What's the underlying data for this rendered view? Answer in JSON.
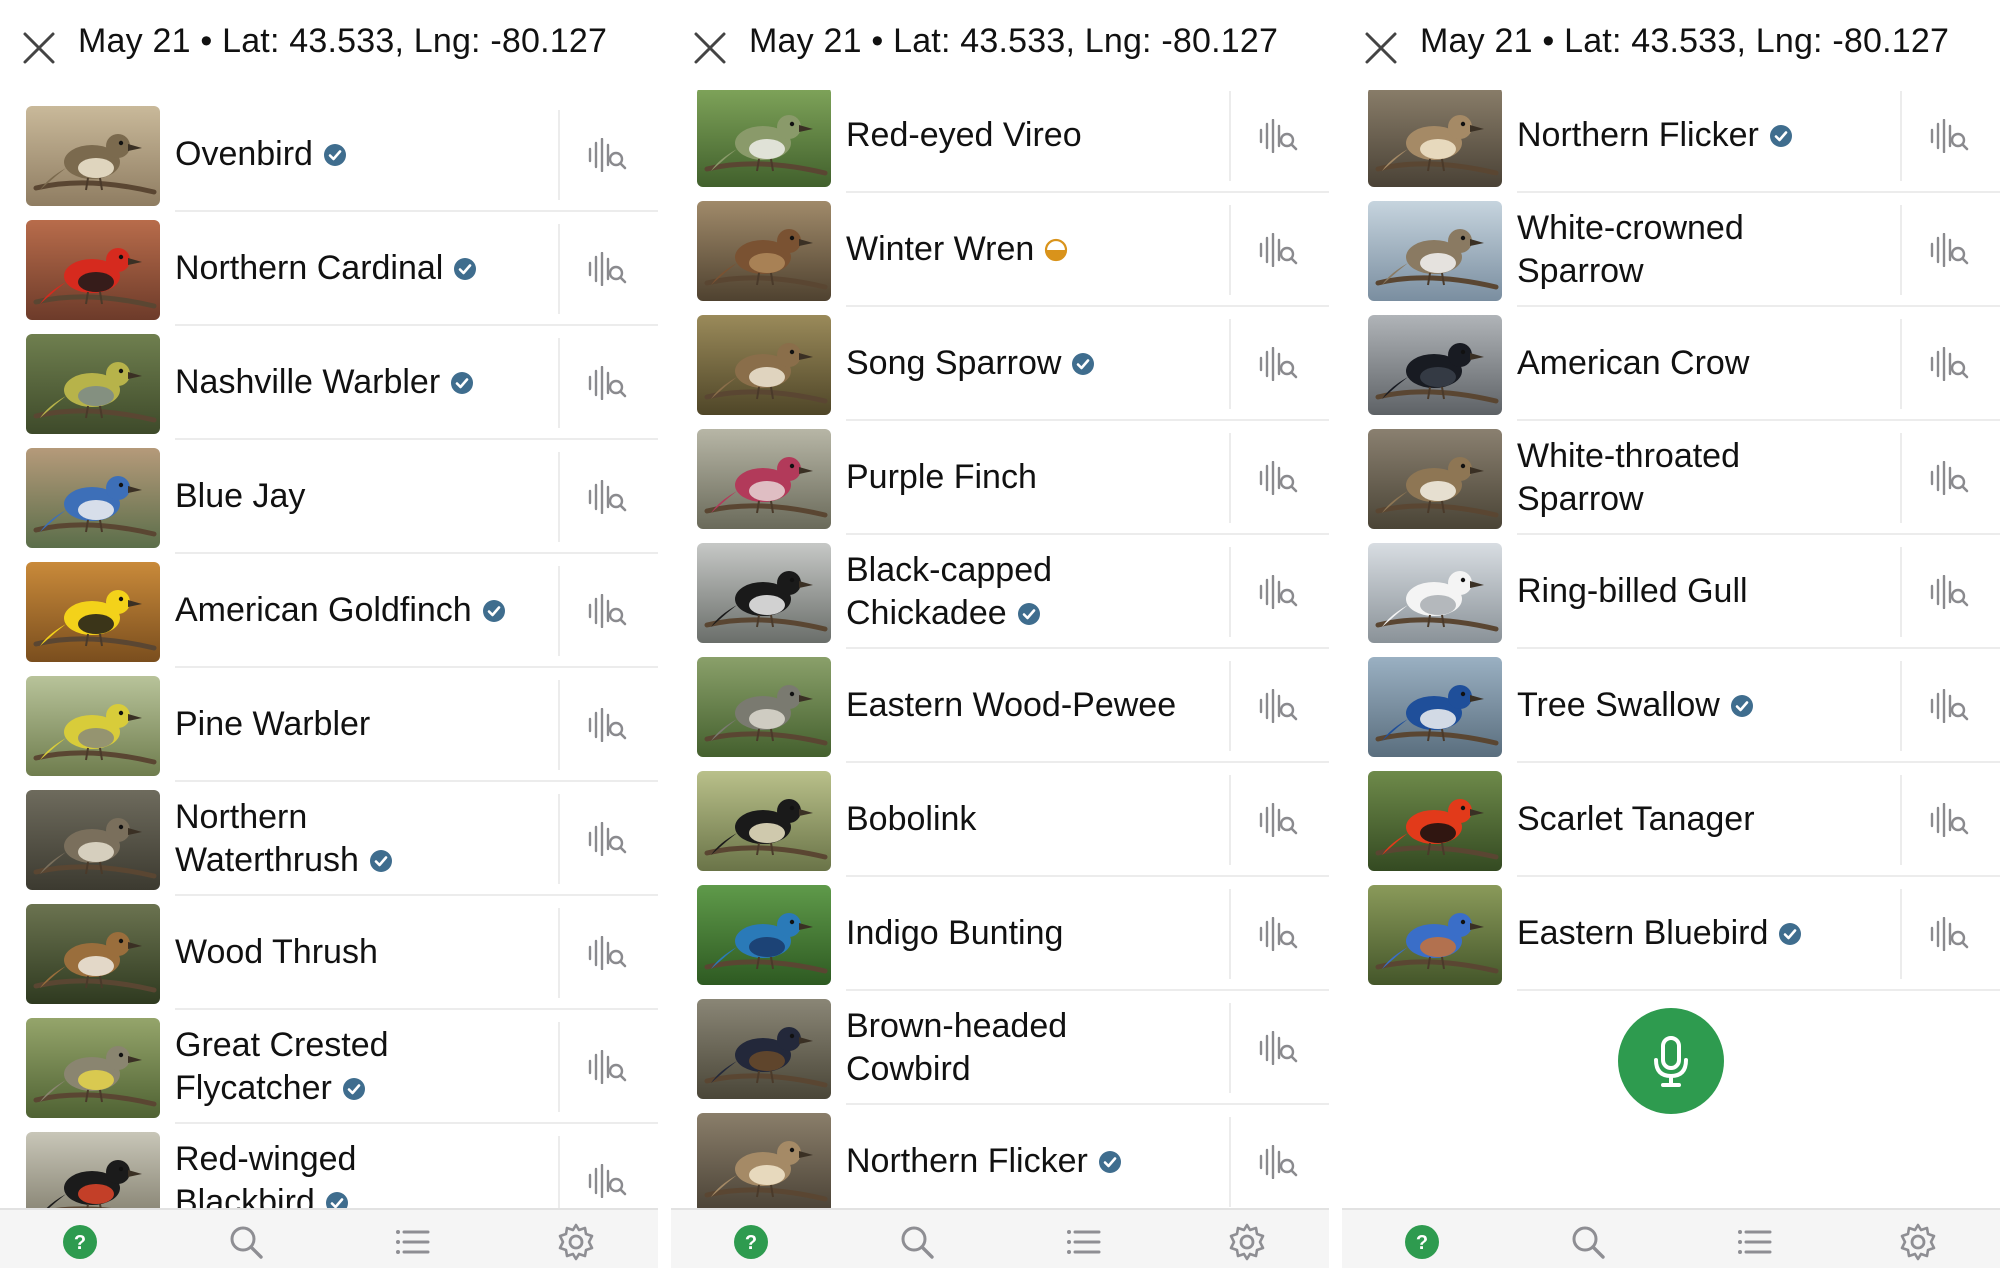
{
  "colors": {
    "accent": "#2e9b4f",
    "badge": "#3f6d8e",
    "partial": "#d9931b",
    "icon": "#8a8a8e"
  },
  "panels": [
    {
      "header": {
        "title": "May 21 • Lat: 43.533, Lng: -80.127"
      },
      "birds": [
        {
          "name": "Ovenbird",
          "lines": [
            "Ovenbird"
          ],
          "status": "verified"
        },
        {
          "name": "Northern Cardinal",
          "lines": [
            "Northern Cardinal"
          ],
          "status": "verified"
        },
        {
          "name": "Nashville Warbler",
          "lines": [
            "Nashville Warbler"
          ],
          "status": "verified"
        },
        {
          "name": "Blue Jay",
          "lines": [
            "Blue Jay"
          ],
          "status": "none"
        },
        {
          "name": "American Goldfinch",
          "lines": [
            "American Goldfinch"
          ],
          "status": "verified"
        },
        {
          "name": "Pine Warbler",
          "lines": [
            "Pine Warbler"
          ],
          "status": "none"
        },
        {
          "name": "Northern Waterthrush",
          "lines": [
            "Northern",
            "Waterthrush"
          ],
          "status": "verified"
        },
        {
          "name": "Wood Thrush",
          "lines": [
            "Wood Thrush"
          ],
          "status": "none"
        },
        {
          "name": "Great Crested Flycatcher",
          "lines": [
            "Great Crested",
            "Flycatcher"
          ],
          "status": "verified"
        },
        {
          "name": "Red-winged Blackbird",
          "lines": [
            "Red-winged",
            "Blackbird"
          ],
          "status": "verified"
        }
      ],
      "tabs": [
        "help-icon",
        "search-icon",
        "list-icon",
        "settings-icon"
      ]
    },
    {
      "header": {
        "title": "May 21 • Lat: 43.533, Lng: -80.127"
      },
      "birds": [
        {
          "name": "Red-eyed Vireo",
          "lines": [
            "Red-eyed Vireo"
          ],
          "status": "none"
        },
        {
          "name": "Winter Wren",
          "lines": [
            "Winter Wren"
          ],
          "status": "partial"
        },
        {
          "name": "Song Sparrow",
          "lines": [
            "Song Sparrow"
          ],
          "status": "verified"
        },
        {
          "name": "Purple Finch",
          "lines": [
            "Purple Finch"
          ],
          "status": "none"
        },
        {
          "name": "Black-capped Chickadee",
          "lines": [
            "Black-capped",
            "Chickadee"
          ],
          "status": "verified"
        },
        {
          "name": "Eastern Wood-Pewee",
          "lines": [
            "Eastern Wood-Pewee"
          ],
          "status": "none"
        },
        {
          "name": "Bobolink",
          "lines": [
            "Bobolink"
          ],
          "status": "none"
        },
        {
          "name": "Indigo Bunting",
          "lines": [
            "Indigo Bunting"
          ],
          "status": "none"
        },
        {
          "name": "Brown-headed Cowbird",
          "lines": [
            "Brown-headed",
            "Cowbird"
          ],
          "status": "none"
        },
        {
          "name": "Northern Flicker",
          "lines": [
            "Northern Flicker"
          ],
          "status": "verified"
        }
      ],
      "tabs": [
        "help-icon",
        "search-icon",
        "list-icon",
        "settings-icon"
      ]
    },
    {
      "header": {
        "title": "May 21 • Lat: 43.533, Lng: -80.127"
      },
      "birds": [
        {
          "name": "Northern Flicker",
          "lines": [
            "Northern Flicker"
          ],
          "status": "verified"
        },
        {
          "name": "White-crowned Sparrow",
          "lines": [
            "White-crowned",
            "Sparrow"
          ],
          "status": "none"
        },
        {
          "name": "American Crow",
          "lines": [
            "American Crow"
          ],
          "status": "none"
        },
        {
          "name": "White-throated Sparrow",
          "lines": [
            "White-throated",
            "Sparrow"
          ],
          "status": "none"
        },
        {
          "name": "Ring-billed Gull",
          "lines": [
            "Ring-billed Gull"
          ],
          "status": "none"
        },
        {
          "name": "Tree Swallow",
          "lines": [
            "Tree Swallow"
          ],
          "status": "verified"
        },
        {
          "name": "Scarlet Tanager",
          "lines": [
            "Scarlet Tanager"
          ],
          "status": "none"
        },
        {
          "name": "Eastern Bluebird",
          "lines": [
            "Eastern Bluebird"
          ],
          "status": "verified"
        }
      ],
      "record_button": {
        "icon": "microphone-icon"
      },
      "tabs": [
        "help-icon",
        "search-icon",
        "list-icon",
        "settings-icon"
      ]
    }
  ]
}
